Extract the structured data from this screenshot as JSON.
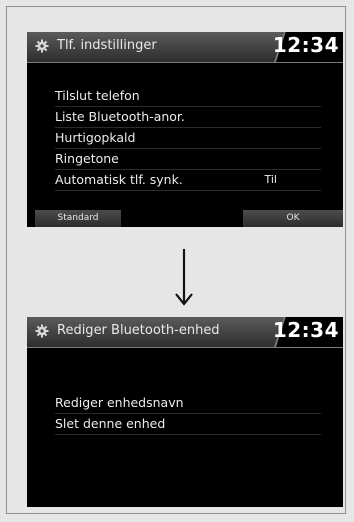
{
  "screen1": {
    "title": "Tlf. indstillinger",
    "clock": "12:34",
    "items": [
      {
        "label": "Tilslut telefon",
        "value": ""
      },
      {
        "label": "Liste Bluetooth-anor.",
        "value": ""
      },
      {
        "label": "Hurtigopkald",
        "value": ""
      },
      {
        "label": "Ringetone",
        "value": ""
      },
      {
        "label": "Automatisk tlf. synk.",
        "value": "Til"
      }
    ],
    "buttons": {
      "left": "Standard",
      "right": "OK"
    }
  },
  "arrow": {
    "icon": "arrow-down-icon"
  },
  "screen2": {
    "title": "Rediger Bluetooth-enhed",
    "clock": "12:34",
    "items": [
      {
        "label": "Rediger enhedsnavn"
      },
      {
        "label": "Slet denne enhed"
      }
    ]
  },
  "colors": {
    "screen_bg": "#000000",
    "header_bg": "#3a3a3a",
    "text": "#ececec",
    "page_bg": "#e6e6e6"
  }
}
